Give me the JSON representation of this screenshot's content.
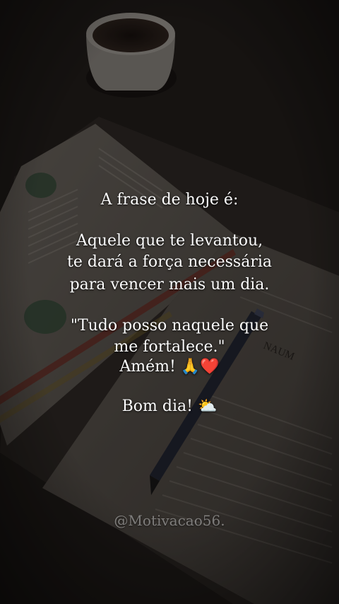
{
  "post": {
    "intro": "A frase de hoje é:",
    "quote_lines": [
      "Aquele que te levantou,",
      "te dará a força necessária",
      "para vencer mais um dia."
    ],
    "verse_lines": [
      "\"Tudo posso naquele que",
      "me fortalece.\""
    ],
    "amen": {
      "text": "Amém!",
      "emojis": "🙏❤️"
    },
    "greeting": {
      "text": "Bom dia!",
      "emoji": "⛅"
    }
  },
  "watermark": {
    "handle": "@Motivacao56."
  },
  "background": {
    "book_heading": "NAUM",
    "icons": [
      "coffee-cup",
      "open-bible",
      "pen",
      "bookmark"
    ]
  }
}
